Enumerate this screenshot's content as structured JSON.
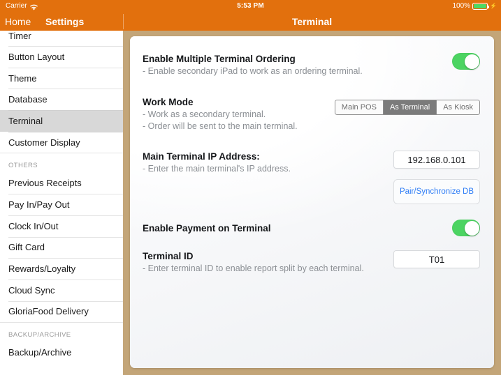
{
  "statusbar": {
    "carrier": "Carrier",
    "wifi_icon": "wifi-icon",
    "time": "5:53 PM",
    "battery_percent": "100%",
    "battery_icon": "battery-full-icon",
    "charging_icon": "lightning-bolt-icon"
  },
  "navbar": {
    "home": "Home",
    "settings": "Settings",
    "title": "Terminal"
  },
  "sidebar": {
    "items": [
      {
        "label": "Timer",
        "selected": false,
        "partial": true
      },
      {
        "label": "Button Layout",
        "selected": false
      },
      {
        "label": "Theme",
        "selected": false
      },
      {
        "label": "Database",
        "selected": false
      },
      {
        "label": "Terminal",
        "selected": true
      },
      {
        "label": "Customer Display",
        "selected": false
      }
    ],
    "section_others": "OTHERS",
    "others": [
      {
        "label": "Previous Receipts"
      },
      {
        "label": "Pay In/Pay Out"
      },
      {
        "label": "Clock In/Out"
      },
      {
        "label": "Gift Card"
      },
      {
        "label": "Rewards/Loyalty"
      },
      {
        "label": "Cloud Sync"
      },
      {
        "label": "GloriaFood Delivery"
      }
    ],
    "section_backup": "BACKUP/ARCHIVE",
    "backup": [
      {
        "label": "Backup/Archive"
      }
    ]
  },
  "main": {
    "multi_terminal": {
      "title": "Enable Multiple Terminal Ordering",
      "subtitle": "- Enable secondary iPad to work as an ordering terminal.",
      "toggle_state": "on"
    },
    "work_mode": {
      "title": "Work Mode",
      "subtitle_line1": "- Work as a secondary terminal.",
      "subtitle_line2": "- Order will be sent to the main terminal.",
      "options": [
        "Main POS",
        "As Terminal",
        "As Kiosk"
      ],
      "selected": "As Terminal"
    },
    "main_ip": {
      "title": "Main Terminal IP Address:",
      "subtitle": "- Enter the main terminal's IP address.",
      "value": "192.168.0.101",
      "placeholder": "IP Address",
      "pair_button": "Pair/Synchronize DB"
    },
    "payment_on_terminal": {
      "title": "Enable Payment on Terminal",
      "toggle_state": "on"
    },
    "terminal_id": {
      "title": "Terminal ID",
      "subtitle": "- Enter terminal ID to enable report split by each terminal.",
      "value": "T01",
      "placeholder": "ID"
    }
  },
  "colors": {
    "orange": "#e2700d",
    "tan": "#c3a578",
    "toggle_green": "#4cd462",
    "link_blue": "#2f7df6",
    "segment_active": "#7b7b7b"
  }
}
